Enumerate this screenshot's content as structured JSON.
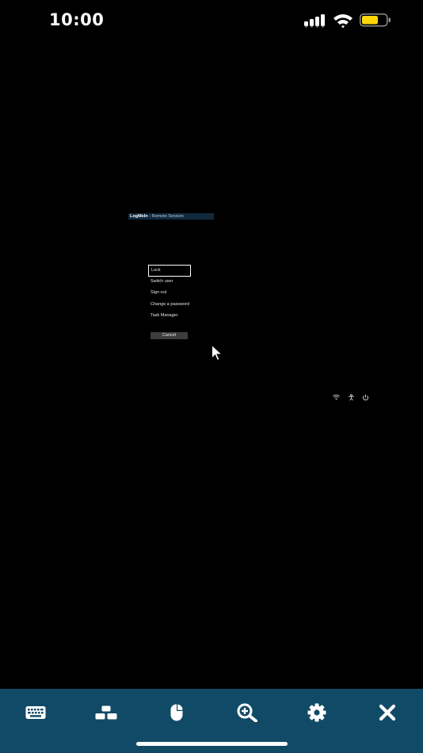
{
  "status_bar": {
    "time": "10:00",
    "icons": [
      "signal-icon",
      "wifi-icon",
      "battery-icon"
    ],
    "battery_color": "#ffd60a"
  },
  "session": {
    "brand": "LogMeIn",
    "subtitle": " - Remote Session",
    "title_bg": "#10293d"
  },
  "menu": {
    "items": [
      {
        "label": "Lock",
        "selected": true
      },
      {
        "label": "Switch user",
        "selected": false
      },
      {
        "label": "Sign out",
        "selected": false
      },
      {
        "label": "Change a password",
        "selected": false
      },
      {
        "label": "Task Manager",
        "selected": false
      }
    ],
    "cancel_label": "Cancel"
  },
  "tray": {
    "icons": [
      "network-icon",
      "accessibility-icon",
      "power-icon"
    ]
  },
  "toolbar": {
    "background": "#114a66",
    "buttons": [
      {
        "icon": "keyboard-icon"
      },
      {
        "icon": "display-switch-icon"
      },
      {
        "icon": "mouse-icon"
      },
      {
        "icon": "zoom-icon"
      },
      {
        "icon": "settings-gear-icon"
      },
      {
        "icon": "close-icon"
      }
    ]
  }
}
